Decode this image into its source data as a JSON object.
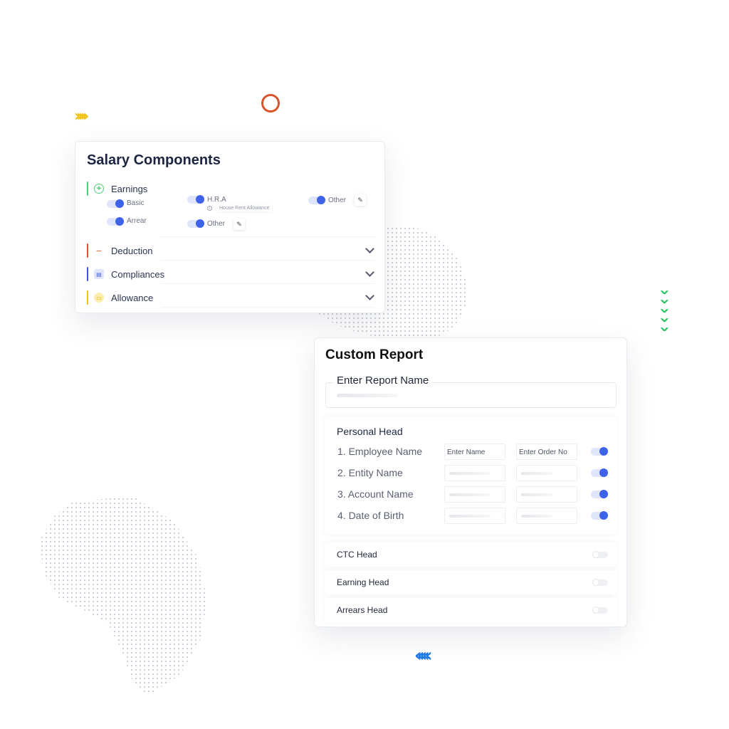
{
  "decorations": {
    "yellow_chevrons": "›››››",
    "blue_chevrons": "‹‹‹‹‹",
    "green_chevrons": [
      "›",
      "›",
      "›",
      "›",
      "›"
    ],
    "colors": {
      "yellow": "#f2c219",
      "blue": "#1f7ae8",
      "green": "#22c55e",
      "ring": "#d9542b"
    }
  },
  "salary_components": {
    "title": "Salary Components",
    "sections": {
      "earnings": {
        "label": "Earnings",
        "icon": "plus-circle-icon",
        "color": "#4ed37c",
        "items": [
          {
            "label": "Basic",
            "enabled": true
          },
          {
            "label": "Arrear",
            "enabled": true
          },
          {
            "label": "H.R.A",
            "enabled": true,
            "hint": "House Rent Allowance"
          },
          {
            "label": "Other",
            "enabled": true,
            "editable": true
          },
          {
            "label": "Other",
            "enabled": true,
            "editable": true
          }
        ]
      },
      "deduction": {
        "label": "Deduction",
        "icon": "minus-icon",
        "color": "#d9542b",
        "expanded": false
      },
      "compliances": {
        "label": "Compliances",
        "icon": "clipboard-icon",
        "color": "#3b5bd9",
        "expanded": false
      },
      "allowance": {
        "label": "Allowance",
        "icon": "ticket-icon",
        "color": "#f2c219",
        "expanded": false
      }
    }
  },
  "custom_report": {
    "title": "Custom Report",
    "report_name_label": "Enter Report Name",
    "personal_head": {
      "title": "Personal Head",
      "rows": [
        {
          "label": "1. Employee Name",
          "name_placeholder": "Enter Name",
          "order_placeholder": "Enter Order No",
          "enabled": true
        },
        {
          "label": "2. Entity Name",
          "enabled": true
        },
        {
          "label": "3. Account Name",
          "enabled": true
        },
        {
          "label": "4. Date of Birth",
          "enabled": true
        }
      ]
    },
    "heads": [
      {
        "label": "CTC Head",
        "enabled": false
      },
      {
        "label": "Earning Head",
        "enabled": false
      },
      {
        "label": "Arrears Head",
        "enabled": false
      }
    ],
    "accent": "#3e63e8"
  }
}
